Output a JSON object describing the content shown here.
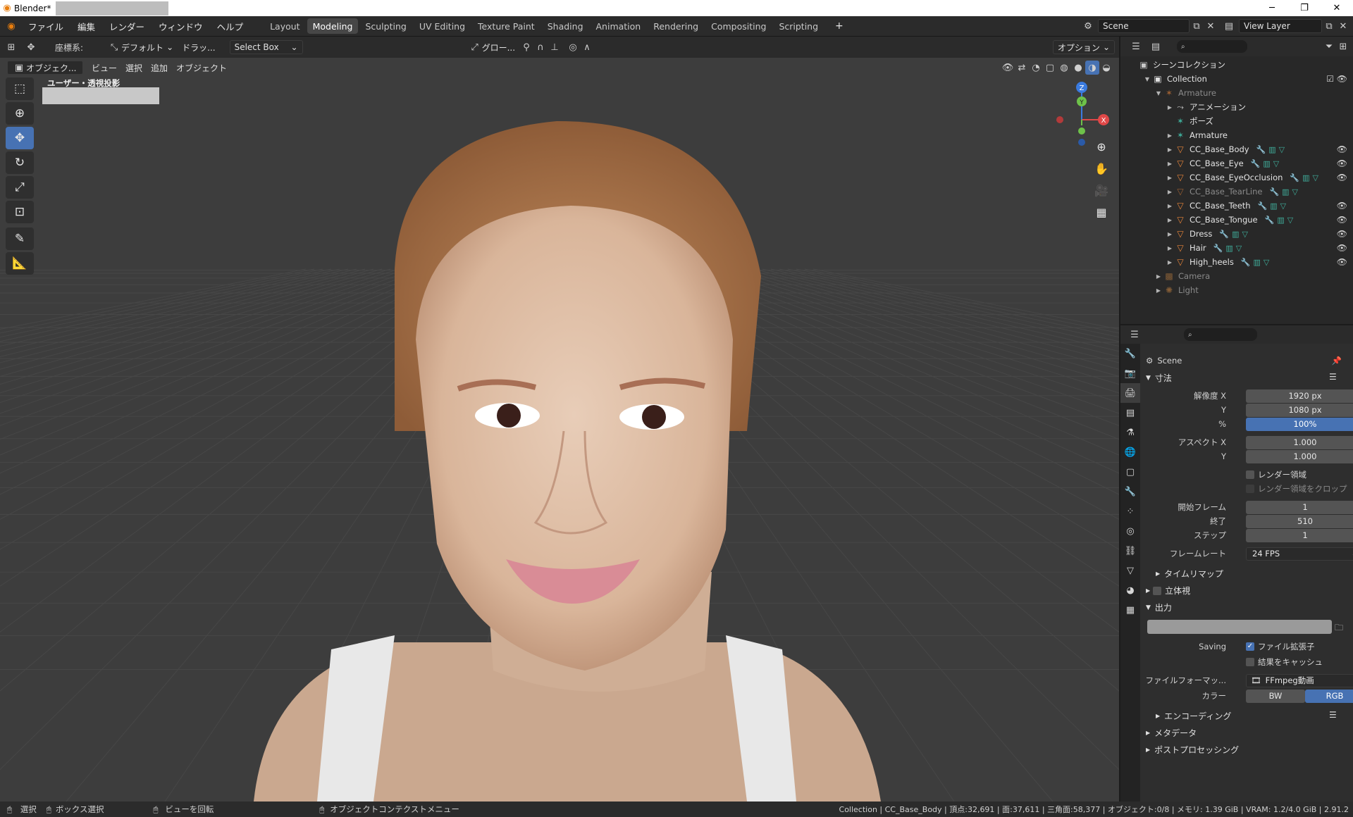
{
  "window": {
    "title": "Blender*",
    "minimize": "─",
    "restore": "❐",
    "close": "✕"
  },
  "menu": {
    "items": [
      "ファイル",
      "編集",
      "レンダー",
      "ウィンドウ",
      "ヘルプ"
    ],
    "workspaces": [
      "Layout",
      "Modeling",
      "Sculpting",
      "UV Editing",
      "Texture Paint",
      "Shading",
      "Animation",
      "Rendering",
      "Compositing",
      "Scripting"
    ],
    "active_workspace": "Modeling",
    "add_tab": "+",
    "scene": "Scene",
    "view_layer": "View Layer"
  },
  "toolheader": {
    "coord_label": "座標系:",
    "orientation": "デフォルト",
    "drag": "ドラッ...",
    "select_mode": "Select Box",
    "pivot": "グロー...",
    "options": "オプション"
  },
  "viewport_header": {
    "mode": "オブジェク...",
    "menus": [
      "ビュー",
      "選択",
      "追加",
      "オブジェクト"
    ],
    "view_label": "ユーザー・透視投影"
  },
  "gizmo": {
    "z": "Z",
    "y": "Y",
    "x": "X"
  },
  "outliner": {
    "root": "シーンコレクション",
    "rows": [
      {
        "name": "Collection",
        "depth": 1,
        "icon": "collection-icon"
      },
      {
        "name": "Armature",
        "depth": 2,
        "icon": "armature-icon",
        "dim": true
      },
      {
        "name": "アニメーション",
        "depth": 3,
        "icon": "action-icon"
      },
      {
        "name": "ポーズ",
        "depth": 3,
        "icon": "pose-icon"
      },
      {
        "name": "Armature",
        "depth": 3,
        "icon": "armature-data-icon"
      },
      {
        "name": "CC_Base_Body",
        "depth": 3,
        "icon": "mesh-icon"
      },
      {
        "name": "CC_Base_Eye",
        "depth": 3,
        "icon": "mesh-icon"
      },
      {
        "name": "CC_Base_EyeOcclusion",
        "depth": 3,
        "icon": "mesh-icon"
      },
      {
        "name": "CC_Base_TearLine",
        "depth": 3,
        "icon": "mesh-icon",
        "dim": true
      },
      {
        "name": "CC_Base_Teeth",
        "depth": 3,
        "icon": "mesh-icon"
      },
      {
        "name": "CC_Base_Tongue",
        "depth": 3,
        "icon": "mesh-icon"
      },
      {
        "name": "Dress",
        "depth": 3,
        "icon": "mesh-icon"
      },
      {
        "name": "Hair",
        "depth": 3,
        "icon": "mesh-icon"
      },
      {
        "name": "High_heels",
        "depth": 3,
        "icon": "mesh-icon"
      },
      {
        "name": "Camera",
        "depth": 2,
        "icon": "camera-icon",
        "dim": true
      },
      {
        "name": "Light",
        "depth": 2,
        "icon": "light-icon",
        "dim": true
      }
    ]
  },
  "properties": {
    "context": "Scene",
    "dimensions": {
      "header": "寸法",
      "res_x_label": "解像度 X",
      "res_x": "1920 px",
      "res_y_label": "Y",
      "res_y": "1080 px",
      "pct_label": "%",
      "pct": "100%",
      "aspect_x_label": "アスペクト X",
      "aspect_x": "1.000",
      "aspect_y_label": "Y",
      "aspect_y": "1.000",
      "render_region": "レンダー領域",
      "crop_region": "レンダー領域をクロップ",
      "frame_start_label": "開始フレーム",
      "frame_start": "1",
      "frame_end_label": "終了",
      "frame_end": "510",
      "frame_step_label": "ステップ",
      "frame_step": "1",
      "framerate_label": "フレームレート",
      "framerate": "24 FPS",
      "time_remap": "タイムリマップ"
    },
    "stereo": "立体視",
    "output": {
      "header": "出力",
      "saving_label": "Saving",
      "file_ext": "ファイル拡張子",
      "cache_result": "結果をキャッシュ",
      "file_format_label": "ファイルフォーマッ...",
      "file_format": "FFmpeg動画",
      "color_label": "カラー",
      "color_bw": "BW",
      "color_rgb": "RGB",
      "encoding": "エンコーディング"
    },
    "metadata": "メタデータ",
    "post": "ポストプロセッシング"
  },
  "status": {
    "select": "選択",
    "box_select": "ボックス選択",
    "rotate_view": "ビューを回転",
    "context_menu": "オブジェクトコンテクストメニュー",
    "stats": "Collection | CC_Base_Body | 頂点:32,691 | 面:37,611 | 三角面:58,377 | オブジェクト:0/8 | メモリ: 1.39 GiB | VRAM: 1.2/4.0 GiB | 2.91.2"
  },
  "colors": {
    "accent": "#4772b3",
    "mesh": "#e8853a",
    "bone": "#3fae9b"
  }
}
